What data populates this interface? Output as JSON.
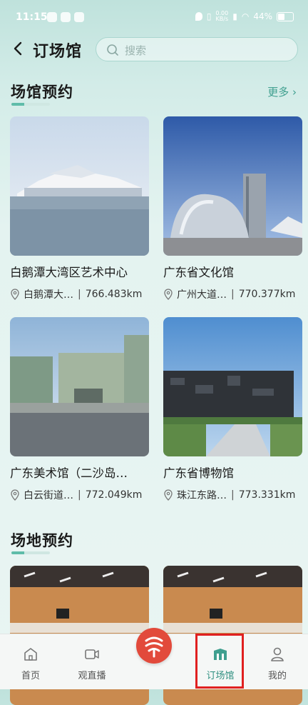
{
  "status_bar": {
    "time": "11:15",
    "net_speed": "0.00\nKB/s",
    "battery": "44%"
  },
  "header": {
    "title": "订场馆",
    "search_placeholder": "搜索"
  },
  "venue_section": {
    "title": "场馆预约",
    "more": "更多",
    "items": [
      {
        "name": "白鹅潭大湾区艺术中心",
        "address": "白鹅潭大…",
        "distance": "766.483km"
      },
      {
        "name": "广东省文化馆",
        "address": "广州大道…",
        "distance": "770.377km"
      },
      {
        "name": "广东美术馆（二沙岛…",
        "address": "白云街道…",
        "distance": "772.049km"
      },
      {
        "name": "广东省博物馆",
        "address": "珠江东路…",
        "distance": "773.331km"
      }
    ]
  },
  "place_section": {
    "title": "场地预约"
  },
  "tabs": [
    {
      "label": "首页",
      "icon": "home-icon"
    },
    {
      "label": "观直播",
      "icon": "video-icon"
    },
    {
      "label": "订场馆",
      "icon": "venue-icon",
      "active": true
    },
    {
      "label": "我的",
      "icon": "profile-icon"
    }
  ],
  "colors": {
    "accent": "#3f9f8f",
    "center_button": "#e24a3b",
    "highlight_box": "#e02020"
  }
}
